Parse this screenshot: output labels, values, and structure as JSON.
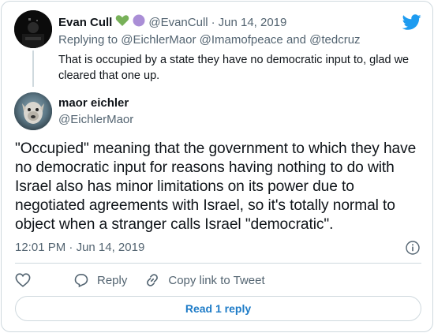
{
  "reply": {
    "author_name": "Evan Cull",
    "author_handle": "@EvanCull",
    "separator": "·",
    "date": "Jun 14, 2019",
    "replying_prefix": "Replying to",
    "mentions": [
      "@EichlerMaor",
      "@Imamofpeace",
      "@tedcruz"
    ],
    "mention_join": "and",
    "text": "That is occupied by a state they have no democratic input to, glad we cleared that one up.",
    "emoji": [
      "green-heart",
      "purple-circle"
    ]
  },
  "main": {
    "author_name": "maor eichler",
    "author_handle": "@EichlerMaor",
    "text": "\"Occupied\" meaning that the government to which they have no democratic input for reasons having nothing to do with Israel also has minor limitations on its power due to negotiated agreements with Israel, so it's totally normal to object when a stranger calls Israel \"democratic\".",
    "time": "12:01 PM",
    "separator": "·",
    "date": "Jun 14, 2019"
  },
  "actions": {
    "reply_label": "Reply",
    "copy_label": "Copy link to Tweet"
  },
  "read_replies_label": "Read 1 reply",
  "colors": {
    "twitter_blue": "#1d9bf0",
    "link_blue": "#1d7bc7",
    "muted": "#536471",
    "border": "#cfd9de"
  }
}
